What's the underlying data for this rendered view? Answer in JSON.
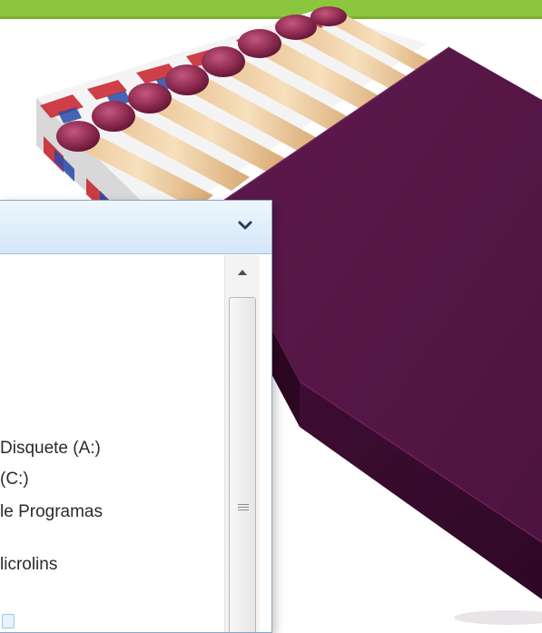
{
  "colors": {
    "accent_green": "#8cc63f",
    "box_purple": "#5b1446",
    "window_header": "#dbe9f7"
  },
  "icons": {
    "chevron": "chevron-down-icon",
    "scroll_up": "scroll-up-arrow-icon",
    "grip": "scroll-grip-icon"
  },
  "drive_list": {
    "items": [
      "Disquete (A:)",
      "(C:)",
      "le Programas",
      "licrolins"
    ]
  }
}
